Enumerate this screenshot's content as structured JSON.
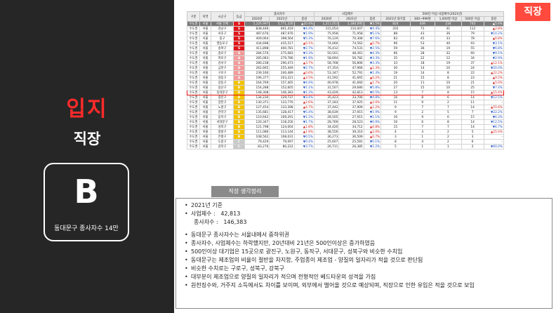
{
  "sidebar": {
    "title": "입지",
    "subtitle": "직장",
    "grade": "B",
    "grade_caption": "동대문구 종사자수 14만"
  },
  "tag": "직장",
  "table": {
    "group_headers": {
      "gu_bun": "구분",
      "region": "지역",
      "sigungu": "시군구",
      "grade": "등급",
      "employees": "종사자수",
      "businesses": "사업체수",
      "large": "500인 이상 사업체수(2021년)"
    },
    "sub_headers": [
      "2020년",
      "2021년",
      "증감",
      "2020년",
      "2021년",
      "증감",
      "2021년 대기업",
      "300~999명",
      "1,000명 이상",
      "500인 이상",
      "증감"
    ],
    "rows": [
      [
        "수도권",
        "서울",
        "서울 전체",
        "S",
        "5,226,997",
        "5,771,226",
        "▲10.4%",
        "1,211,053",
        "1,180,095",
        "▼3.5%",
        "824",
        "449",
        "234",
        "743",
        "▲5.6%"
      ],
      [
        "수도권",
        "서울",
        "강남구",
        "S",
        "838,446",
        "801,419",
        "▼4.4%",
        "115,054",
        "110,007",
        "▼4.4%",
        "202",
        "71",
        "41",
        "112",
        "▲2.8%"
      ],
      [
        "수도권",
        "서울",
        "서초구",
        "S",
        "487,676",
        "487,976",
        "▼1.9%",
        "75,958",
        "71,958",
        "▼5.1%",
        "88",
        "43",
        "36",
        "79",
        "▼10.2%"
      ],
      [
        "수도권",
        "서울",
        "중구",
        "S",
        "409,064",
        "398,564",
        "▼5.3%",
        "76,129",
        "70,308",
        "▼7.6%",
        "83",
        "45",
        "33",
        "78",
        "▲6.8%"
      ],
      [
        "수도권",
        "서울",
        "영등포구",
        "S",
        "434,698",
        "435,517",
        "▲0.1%",
        "74,060",
        "74,562",
        "▲0.7%",
        "96",
        "53",
        "40",
        "93",
        "▼3.1%"
      ],
      [
        "수도권",
        "서울",
        "송파구",
        "S",
        "411,898",
        "400,781",
        "▼2.7%",
        "76,412",
        "74,531",
        "▼2.5%",
        "59",
        "36",
        "19",
        "55",
        "▼6.8%"
      ],
      [
        "수도권",
        "서울",
        "종로구",
        "A",
        "284,570",
        "275,083",
        "▼3.3%",
        "50,501",
        "48,361",
        "▼4.3%",
        "66",
        "28",
        "32",
        "60",
        "▼9.1%"
      ],
      [
        "수도권",
        "서울",
        "마포구",
        "A",
        "285,083",
        "279,786",
        "▼1.9%",
        "58,694",
        "56,782",
        "▼3.3%",
        "35",
        "22",
        "12",
        "34",
        "▼2.9%"
      ],
      [
        "수도권",
        "서울",
        "강서구",
        "A",
        "280,238",
        "290,473",
        "▲3.7%",
        "58,768",
        "56,806",
        "▼3.3%",
        "33",
        "18",
        "19",
        "37",
        "▲12.1%"
      ],
      [
        "수도권",
        "서울",
        "금천구",
        "A",
        "262,665",
        "255,449",
        "▼2.7%",
        "47,354",
        "47,966",
        "▲1.3%",
        "30",
        "14",
        "10",
        "24",
        "▼20.0%"
      ],
      [
        "수도권",
        "서울",
        "구로구",
        "A",
        "239,166",
        "240,489",
        "▲0.6%",
        "53,347",
        "52,791",
        "▼1.4%",
        "19",
        "14",
        "8",
        "22",
        "▲22.2%"
      ],
      [
        "수도권",
        "서울",
        "성동구",
        "A",
        "196,377",
        "203,221",
        "▲3.5%",
        "41,592",
        "41,665",
        "▲0.2%",
        "21",
        "15",
        "8",
        "23",
        "▲9.5%"
      ],
      [
        "수도권",
        "서울",
        "강동구",
        "B",
        "164,769",
        "157,465",
        "▼4.4%",
        "40,978",
        "41,660",
        "▲1.7%",
        "20",
        "11",
        "10",
        "21",
        "▲5.0%"
      ],
      [
        "수도권",
        "서울",
        "용산구",
        "B",
        "154,288",
        "152,605",
        "▼1.1%",
        "31,507",
        "29,680",
        "▼5.8%",
        "27",
        "15",
        "10",
        "25",
        "▼7.4%"
      ],
      [
        "수도권",
        "서울",
        "동대문구",
        "B",
        "148,308",
        "146,383",
        "▼1.3%",
        "43,029",
        "42,813",
        "▼0.5%",
        "13",
        "7",
        "8",
        "15",
        "▲15.4%"
      ],
      [
        "수도권",
        "서울",
        "광진구",
        "B",
        "134,230",
        "129,737",
        "▼3.4%",
        "35,423",
        "33,706",
        "▼4.8%",
        "16",
        "8",
        "6",
        "14",
        "▼12.5%"
      ],
      [
        "수도권",
        "서울",
        "양천구",
        "B",
        "130,371",
        "133,776",
        "▲2.6%",
        "37,183",
        "37,925",
        "▲2.0%",
        "11",
        "9",
        "2",
        "11",
        "-"
      ],
      [
        "수도권",
        "서울",
        "노원구",
        "B",
        "127,454",
        "133,398",
        "▲4.7%",
        "37,442",
        "37,909",
        "▲1.2%",
        "9",
        "7",
        "7",
        "14",
        "▲55.6%"
      ],
      [
        "수도권",
        "서울",
        "관악구",
        "B",
        "135,681",
        "128,417",
        "▼5.4%",
        "38,639",
        "37,915",
        "▼1.9%",
        "9",
        "2",
        "5",
        "7",
        "▼22.2%"
      ],
      [
        "수도권",
        "서울",
        "동작구",
        "B",
        "110,642",
        "109,291",
        "▼1.2%",
        "28,505",
        "27,915",
        "▼2.1%",
        "16",
        "9",
        "6",
        "15",
        "▼6.3%"
      ],
      [
        "수도권",
        "서울",
        "서대문구",
        "B",
        "120,347",
        "118,256",
        "▼1.7%",
        "28,769",
        "28,523",
        "▼0.9%",
        "16",
        "6",
        "8",
        "14",
        "▼12.5%"
      ],
      [
        "수도권",
        "서울",
        "성북구",
        "B",
        "121,798",
        "124,004",
        "▲1.8%",
        "34,420",
        "34,712",
        "▲0.8%",
        "15",
        "7",
        "7",
        "14",
        "▼6.7%"
      ],
      [
        "수도권",
        "서울",
        "중랑구",
        "B",
        "111,086",
        "113,144",
        "▲1.9%",
        "38,556",
        "39,310",
        "▲2.0%",
        "4",
        "3",
        "2",
        "5",
        "▲25.0%"
      ],
      [
        "수도권",
        "서울",
        "은평구",
        "B",
        "108,562",
        "108,031",
        "▼0.5%",
        "36,273",
        "36,509",
        "▲0.7%",
        "3",
        "1",
        "2",
        "3",
        "-"
      ],
      [
        "수도권",
        "서울",
        "도봉구",
        "C",
        "79,429",
        "79,097",
        "▼0.4%",
        "25,607",
        "25,581",
        "▼0.1%",
        "8",
        "4",
        "2",
        "6",
        "-"
      ],
      [
        "수도권",
        "서울",
        "강북구",
        "C",
        "83,276",
        "80,222",
        "▼3.7%",
        "26,711",
        "26,385",
        "▼1.2%",
        "5",
        "1",
        "1",
        "2",
        "▼60.0%"
      ]
    ]
  },
  "notes": {
    "header": "직장 생각정리",
    "year_line": "2021년 기준",
    "businesses_label": "사업체수 :",
    "businesses_value": "42,813",
    "employees_label": "종사자수 :",
    "employees_value": "146,383",
    "items": [
      "동대문구 종사자수는 서울내에서 중하위권",
      "종사자수, 사업체수는 하락했지만, 20년대비 21년은 500인이상은 증가하였음",
      "500인이상 대기업은 15곳으로 광진구, 노원구, 동작구, 서대문구, 성북구와 비슷한 수치임",
      "동대문구는 제조업의 비율이 절반을 차지함, 주업종이 제조업 - 양질의 일자리가 적을 것으로 판단됨",
      "비슷한 수치로는 구로구, 성북구, 강북구",
      "대부분이 제조업으로 양질의 일자리가 적으며 전형적인 베드타운의 성격을 가짐",
      "원천징수와, 거주지 소득에서도 차이를 보이며, 외부에서 벌어올 것으로 예상되며, 직장으로 인한 유입은 적을 것으로 보임"
    ]
  },
  "colors": {
    "S": "#e0161b",
    "A": "#f39a9a",
    "B": "#f2c200",
    "C": "#c9c9c9",
    "highlight": "#e01010",
    "accent": "#ff2a2a",
    "tag_bg": "#ff4a3d"
  }
}
